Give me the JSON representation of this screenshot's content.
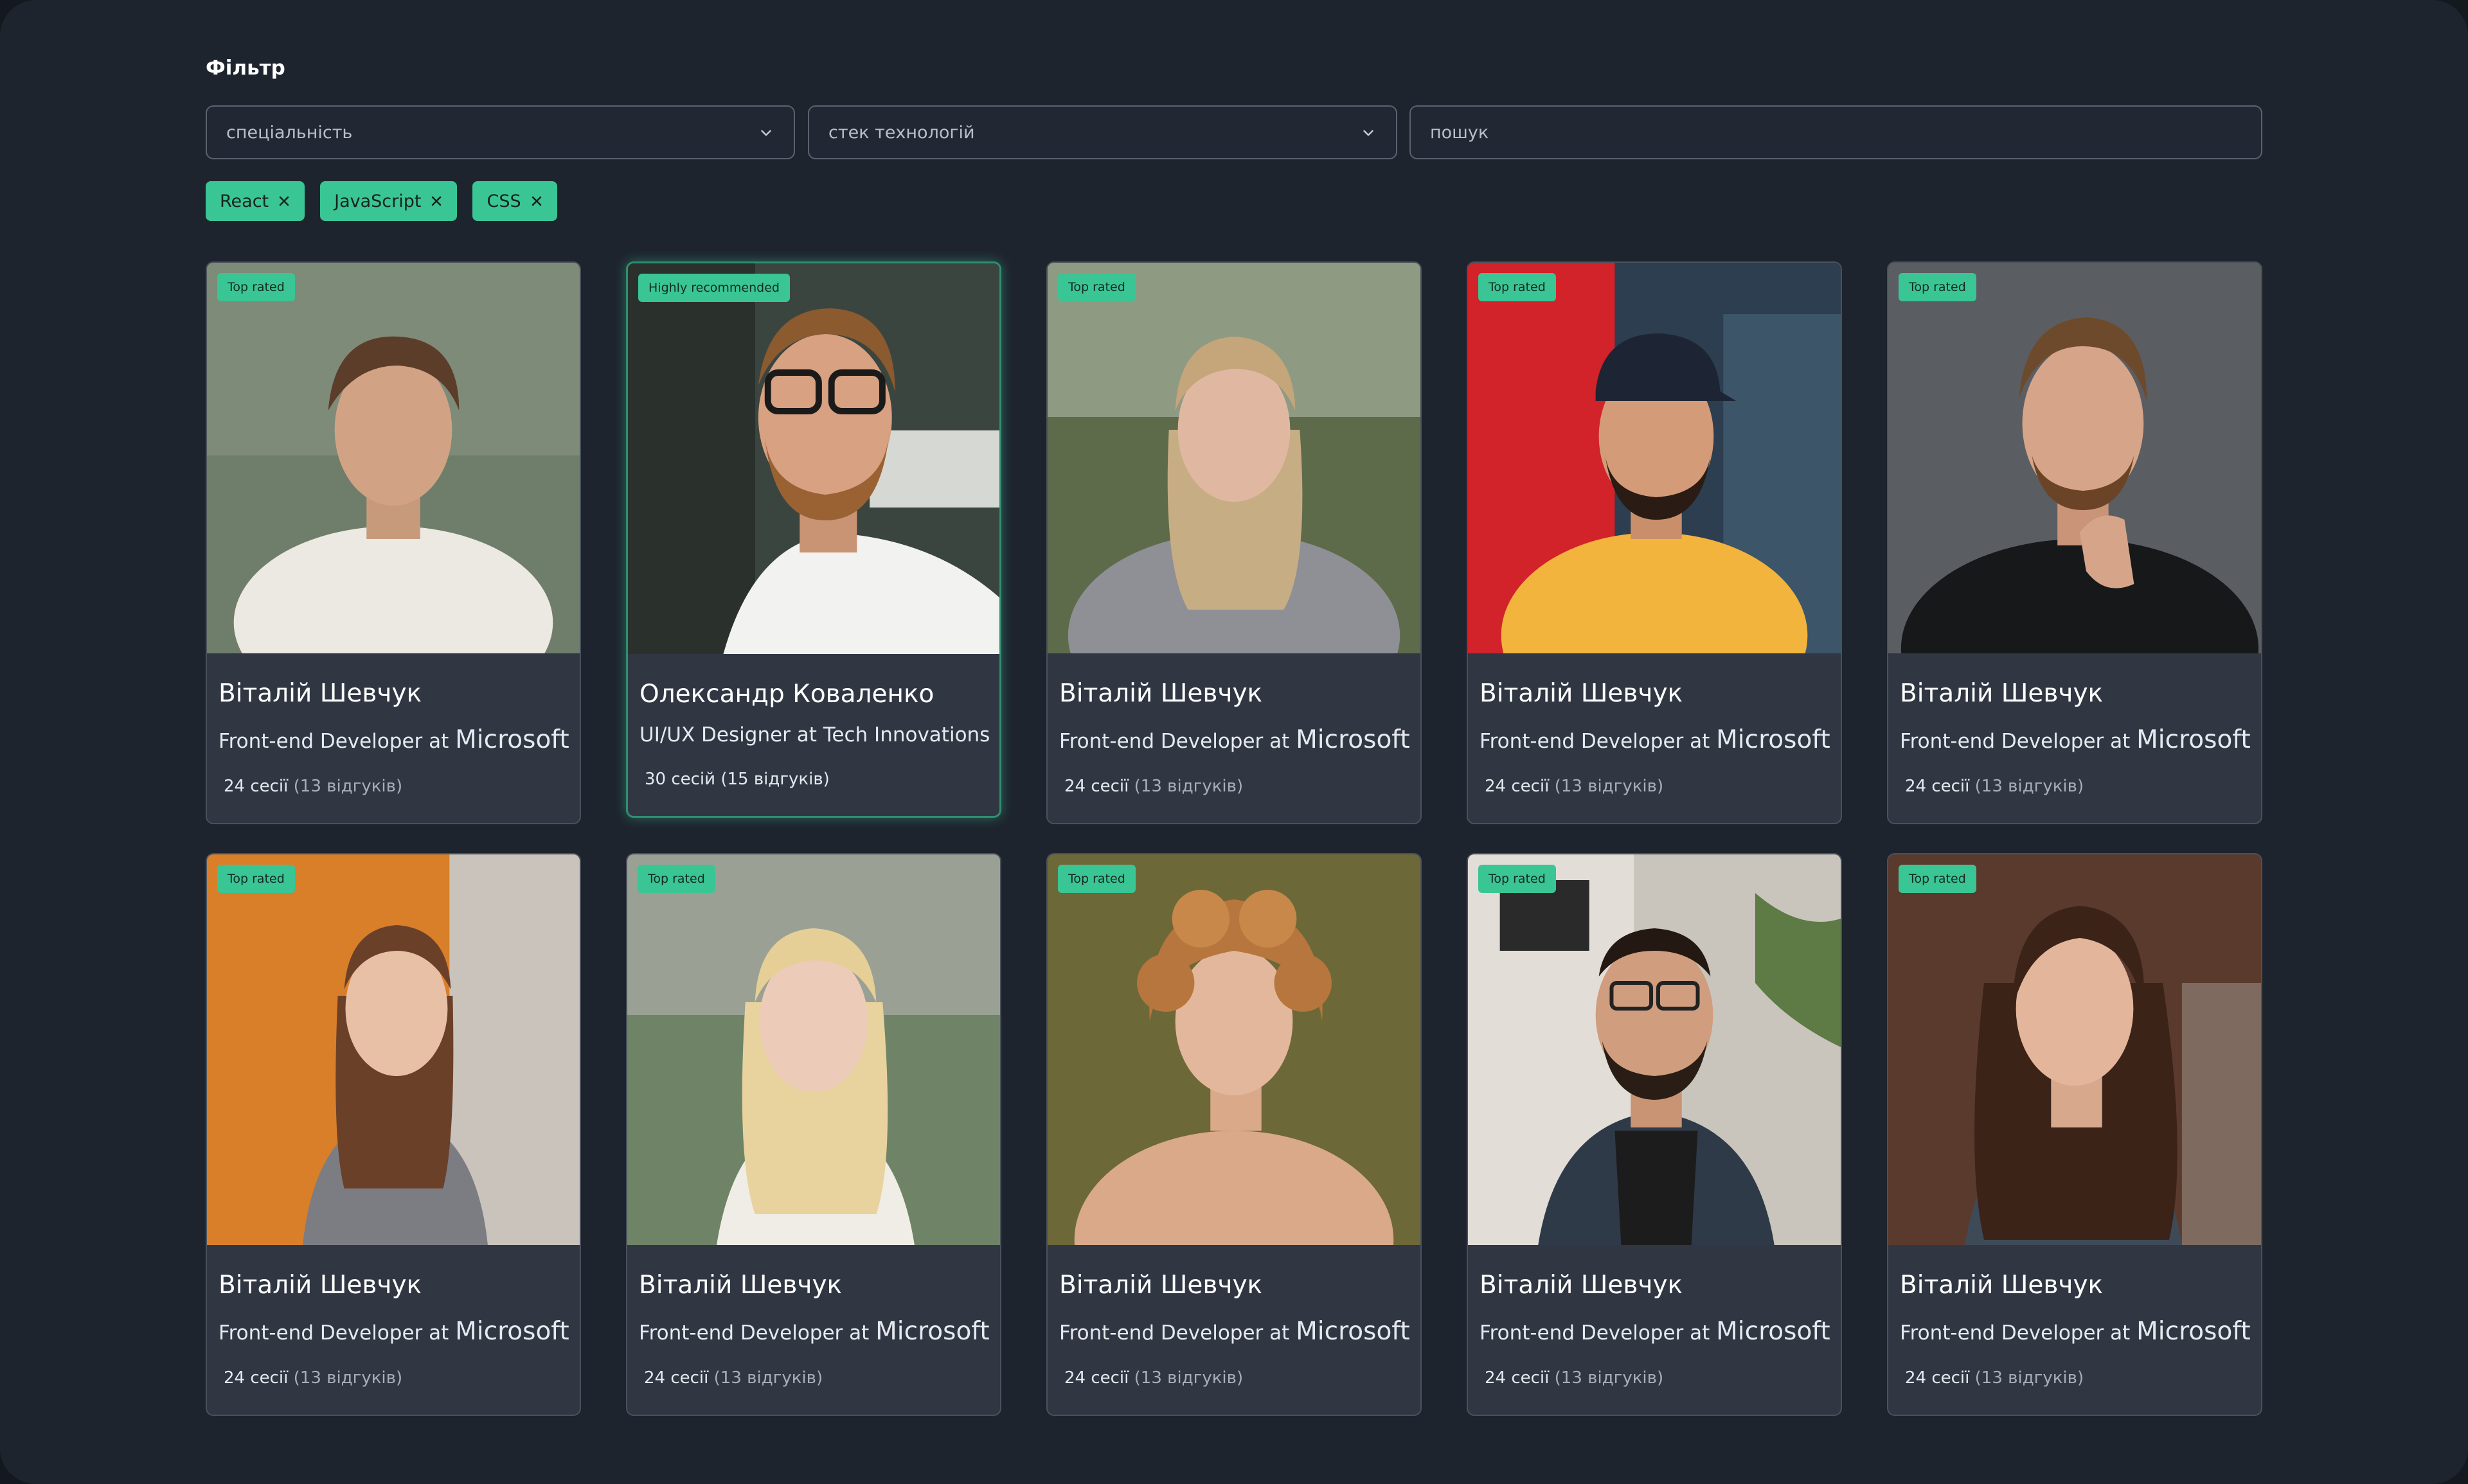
{
  "filter": {
    "title": "Фільтр",
    "specialty_placeholder": "спеціальність",
    "stack_placeholder": "стек технологій",
    "search_placeholder": "пошук",
    "tags": [
      {
        "label": "React"
      },
      {
        "label": "JavaScript"
      },
      {
        "label": "CSS"
      }
    ]
  },
  "colors": {
    "accent": "#3ac594",
    "background": "#1e242e",
    "card": "#303743"
  },
  "cards": [
    {
      "badge": "Top rated",
      "name": "Віталій Шевчук",
      "role": "Front-end Developer at",
      "company": "Microsoft",
      "sessions": "24 сесії",
      "reviews": "(13 відгуків)"
    },
    {
      "badge": "Highly recommended",
      "name": "Олександр Коваленко",
      "role": "UI/UX Designer at Tech Innovations",
      "company": "",
      "sessions": "30 сесій",
      "reviews": "(15 відгуків)"
    },
    {
      "badge": "Top rated",
      "name": "Віталій Шевчук",
      "role": "Front-end Developer at",
      "company": "Microsoft",
      "sessions": "24 сесії",
      "reviews": "(13 відгуків)"
    },
    {
      "badge": "Top rated",
      "name": "Віталій Шевчук",
      "role": "Front-end Developer at",
      "company": "Microsoft",
      "sessions": "24 сесії",
      "reviews": "(13 відгуків)"
    },
    {
      "badge": "Top rated",
      "name": "Віталій Шевчук",
      "role": "Front-end Developer at",
      "company": "Microsoft",
      "sessions": "24 сесії",
      "reviews": "(13 відгуків)"
    },
    {
      "badge": "Top rated",
      "name": "Віталій Шевчук",
      "role": "Front-end Developer at",
      "company": "Microsoft",
      "sessions": "24 сесії",
      "reviews": "(13 відгуків)"
    },
    {
      "badge": "Top rated",
      "name": "Віталій Шевчук",
      "role": "Front-end Developer at",
      "company": "Microsoft",
      "sessions": "24 сесії",
      "reviews": "(13 відгуків)"
    },
    {
      "badge": "Top rated",
      "name": "Віталій Шевчук",
      "role": "Front-end Developer at",
      "company": "Microsoft",
      "sessions": "24 сесії",
      "reviews": "(13 відгуків)"
    },
    {
      "badge": "Top rated",
      "name": "Віталій Шевчук",
      "role": "Front-end Developer at",
      "company": "Microsoft",
      "sessions": "24 сесії",
      "reviews": "(13 відгуків)"
    },
    {
      "badge": "Top rated",
      "name": "Віталій Шевчук",
      "role": "Front-end Developer at",
      "company": "Microsoft",
      "sessions": "24 сесії",
      "reviews": "(13 відгуків)"
    }
  ]
}
